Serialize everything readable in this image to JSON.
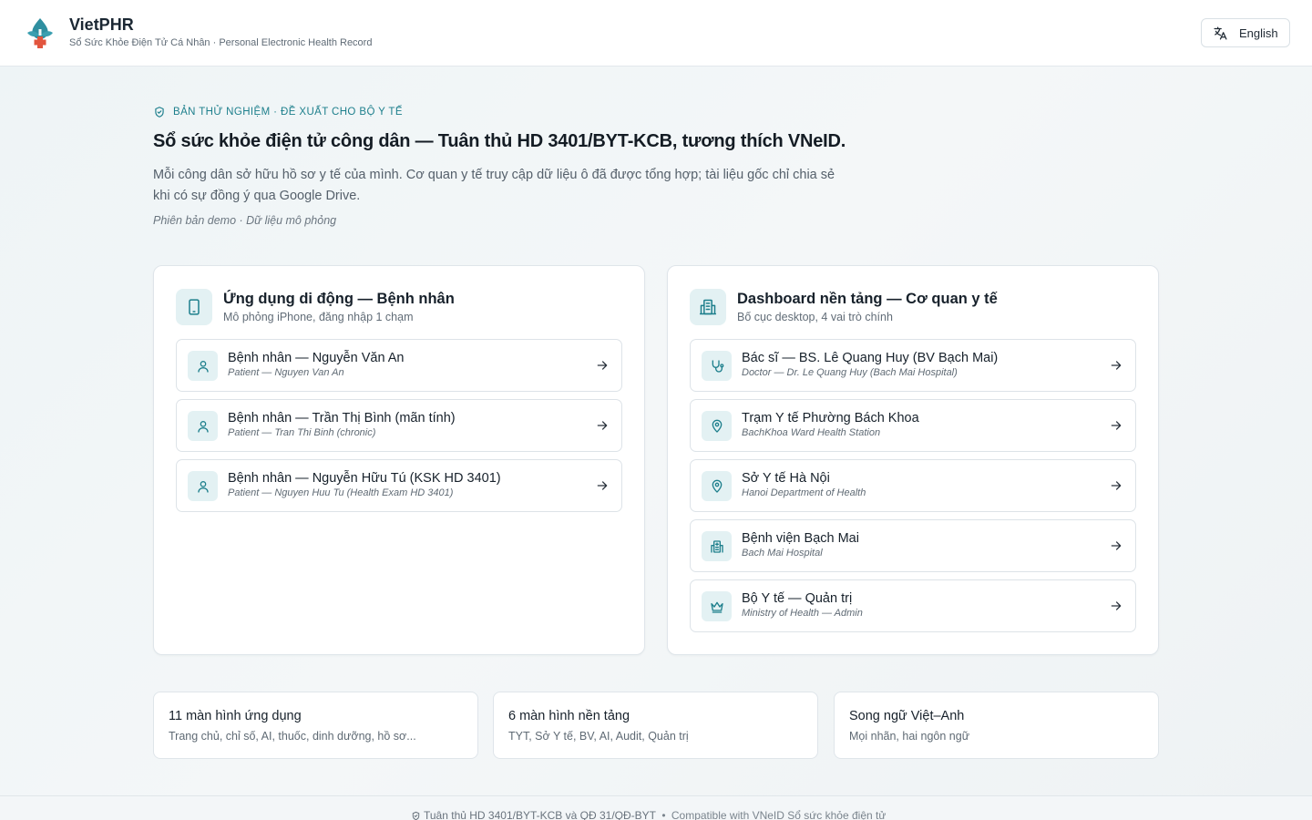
{
  "header": {
    "app_name": "VietPHR",
    "subtitle": "Sổ Sức Khỏe Điện Tử Cá Nhân · Personal Electronic Health Record",
    "language_button": "English"
  },
  "hero": {
    "badge": "Bản thử nghiệm · Đề xuất cho Bộ Y tế",
    "headline": "Sổ sức khỏe điện tử công dân — Tuân thủ HD 3401/BYT-KCB, tương thích VNeID.",
    "intro": "Mỗi công dân sở hữu hồ sơ y tế của mình. Cơ quan y tế truy cập dữ liệu ô đã được tổng hợp; tài liệu gốc chỉ chia sẻ khi có sự đồng ý qua Google Drive.",
    "demo_note": "Phiên bản demo · Dữ liệu mô phỏng"
  },
  "mobile_panel": {
    "title": "Ứng dụng di động — Bệnh nhân",
    "subtitle": "Mô phỏng iPhone, đăng nhập 1 chạm",
    "items": [
      {
        "title": "Bệnh nhân — Nguyễn Văn An",
        "subtitle": "Patient — Nguyen Van An",
        "icon": "user-icon"
      },
      {
        "title": "Bệnh nhân — Trần Thị Bình (mãn tính)",
        "subtitle": "Patient — Tran Thi Binh (chronic)",
        "icon": "user-icon"
      },
      {
        "title": "Bệnh nhân — Nguyễn Hữu Tú (KSK HD 3401)",
        "subtitle": "Patient — Nguyen Huu Tu (Health Exam HD 3401)",
        "icon": "user-icon"
      }
    ]
  },
  "dashboard_panel": {
    "title": "Dashboard nền tảng — Cơ quan y tế",
    "subtitle": "Bố cục desktop, 4 vai trò chính",
    "items": [
      {
        "title": "Bác sĩ — BS. Lê Quang Huy (BV Bạch Mai)",
        "subtitle": "Doctor — Dr. Le Quang Huy (Bach Mai Hospital)",
        "icon": "stethoscope-icon"
      },
      {
        "title": "Trạm Y tế Phường Bách Khoa",
        "subtitle": "BachKhoa Ward Health Station",
        "icon": "map-pin-icon"
      },
      {
        "title": "Sở Y tế Hà Nội",
        "subtitle": "Hanoi Department of Health",
        "icon": "map-pin-icon"
      },
      {
        "title": "Bệnh viện Bạch Mai",
        "subtitle": "Bach Mai Hospital",
        "icon": "hospital-icon"
      },
      {
        "title": "Bộ Y tế — Quản trị",
        "subtitle": "Ministry of Health — Admin",
        "icon": "crown-icon"
      }
    ]
  },
  "stats": [
    {
      "title": "11 màn hình ứng dụng",
      "subtitle": "Trang chủ, chỉ số, AI, thuốc, dinh dưỡng, hồ sơ..."
    },
    {
      "title": "6 màn hình nền tảng",
      "subtitle": "TYT, Sở Y tế, BV, AI, Audit, Quản trị"
    },
    {
      "title": "Song ngữ Việt–Anh",
      "subtitle": "Mọi nhãn, hai ngôn ngữ"
    }
  ],
  "footer": {
    "compliance": "Tuân thủ HD 3401/BYT-KCB và QĐ 31/QĐ-BYT",
    "separator": " • ",
    "compatibility": "Compatible with VNeID Sổ sức khỏe điện tử"
  },
  "colors": {
    "accent": "#1d7f8c",
    "icon_bg": "#e3f1f3",
    "logo_leaf": "#2f8fa0",
    "logo_cross": "#e2553e"
  }
}
